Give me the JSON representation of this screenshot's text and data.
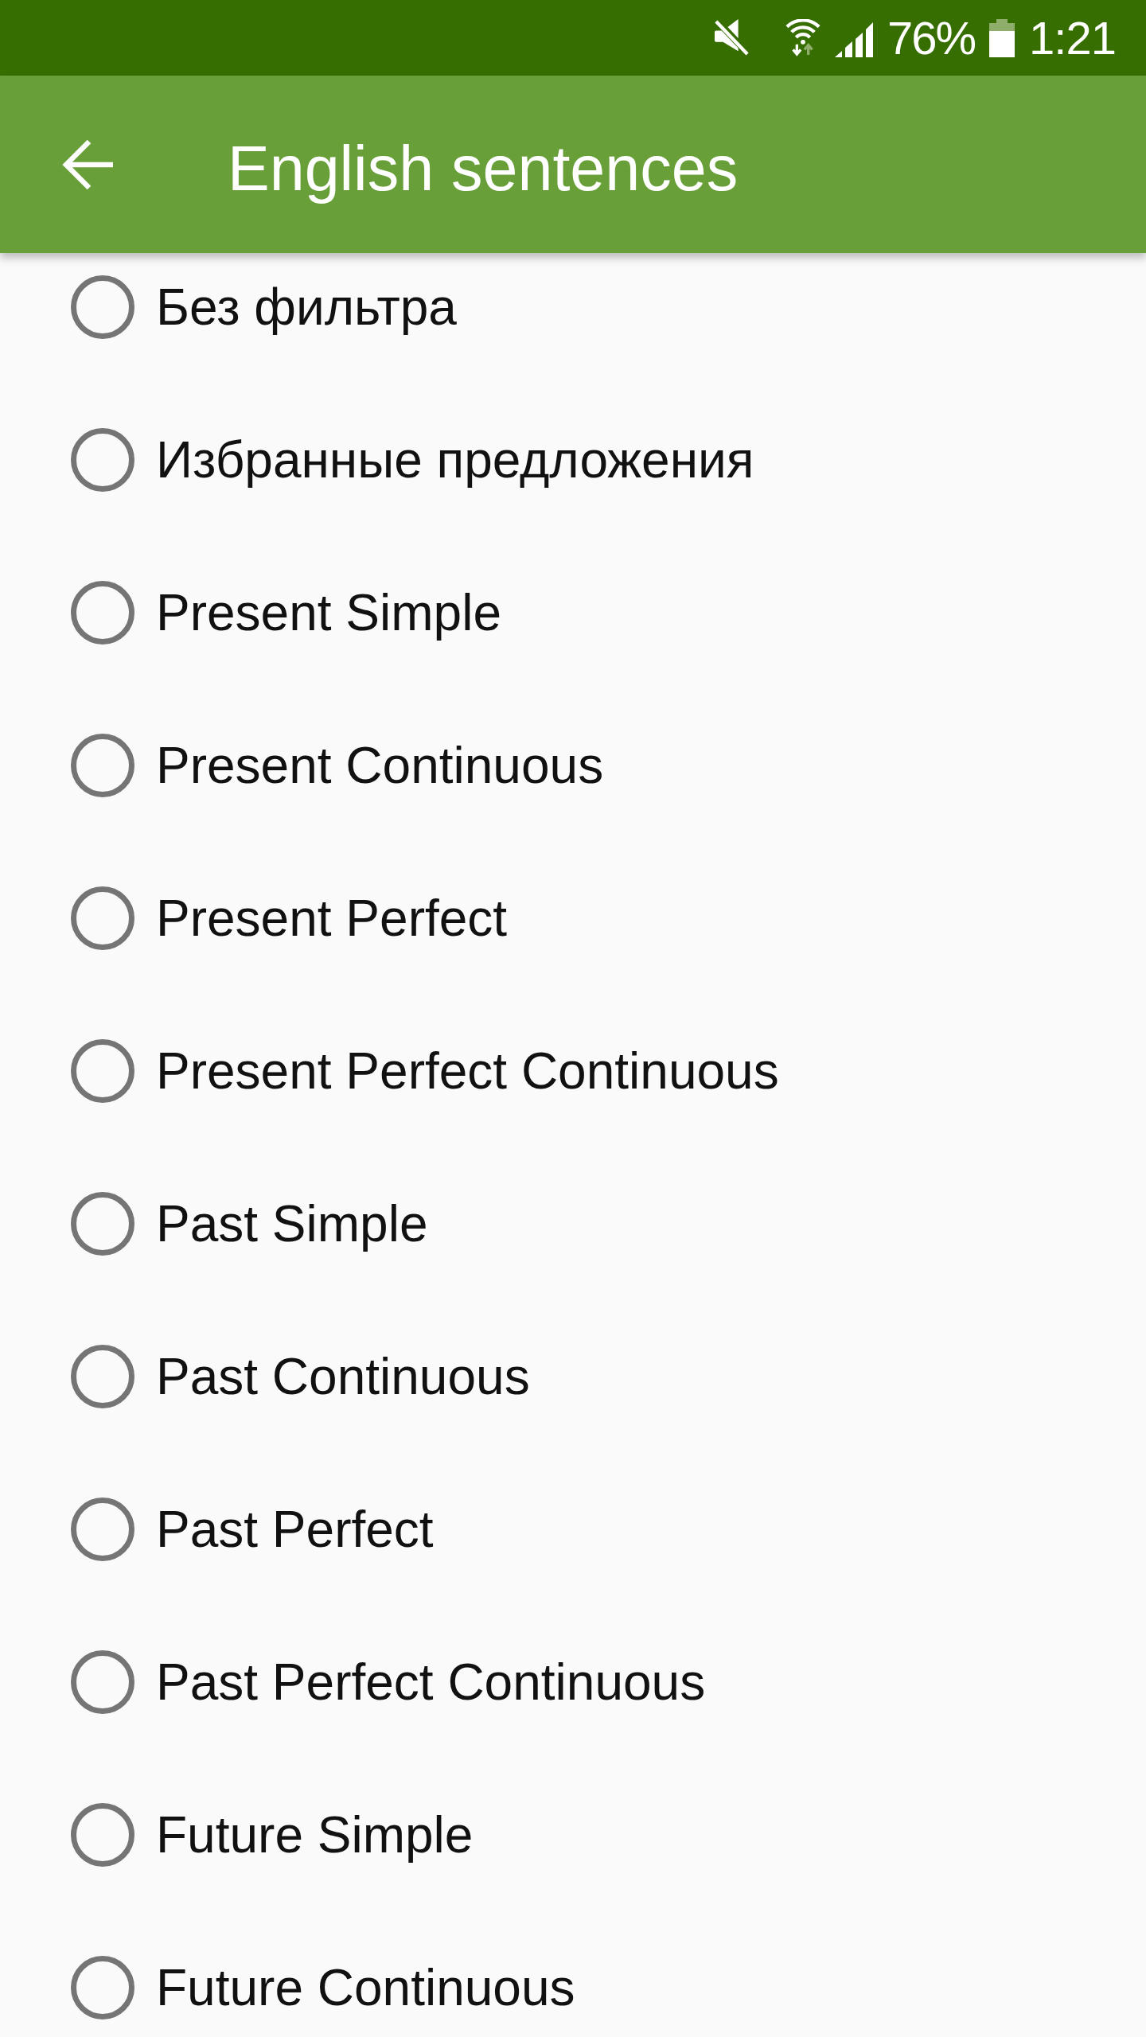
{
  "status_bar": {
    "battery": "76%",
    "time": "1:21"
  },
  "toolbar": {
    "title": "English sentences"
  },
  "filters": [
    {
      "label": "Без фильтра",
      "selected": false
    },
    {
      "label": "Избранные предложения",
      "selected": false
    },
    {
      "label": "Present Simple",
      "selected": false
    },
    {
      "label": "Present Continuous",
      "selected": false
    },
    {
      "label": "Present Perfect",
      "selected": false
    },
    {
      "label": "Present Perfect Continuous",
      "selected": false
    },
    {
      "label": "Past Simple",
      "selected": false
    },
    {
      "label": "Past Continuous",
      "selected": false
    },
    {
      "label": "Past Perfect",
      "selected": false
    },
    {
      "label": "Past Perfect Continuous",
      "selected": false
    },
    {
      "label": "Future Simple",
      "selected": false
    },
    {
      "label": "Future Continuous",
      "selected": false
    }
  ]
}
